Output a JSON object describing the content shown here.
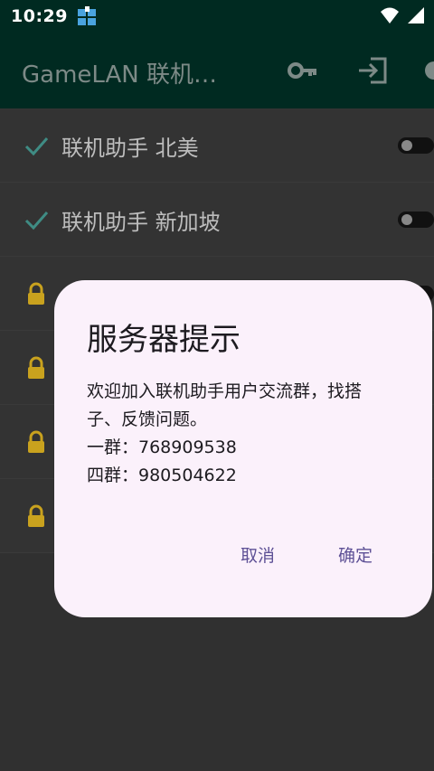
{
  "status": {
    "time": "10:29"
  },
  "toolbar": {
    "title": "GameLAN 联机…"
  },
  "list": {
    "items": [
      {
        "label": "联机助手 北美",
        "icon": "check-icon"
      },
      {
        "label": "联机助手 新加坡",
        "icon": "check-icon"
      },
      {
        "label": "",
        "icon": "lock-icon"
      },
      {
        "label": "",
        "icon": "lock-icon"
      },
      {
        "label": "",
        "icon": "lock-icon"
      },
      {
        "label": "",
        "icon": "lock-icon"
      }
    ]
  },
  "dialog": {
    "title": "服务器提示",
    "body_line1": "欢迎加入联机助手用户交流群，找搭",
    "body_line2": "子、反馈问题。",
    "body_line3": "一群：768909538",
    "body_line4": "四群：980504622",
    "cancel_label": "取消",
    "confirm_label": "确定"
  },
  "colors": {
    "toolbar_bg": "#002a21",
    "dialog_bg": "#fbf1fb",
    "dialog_button": "#5e5196",
    "check": "#3f8c84",
    "lock": "#c9a21e"
  }
}
